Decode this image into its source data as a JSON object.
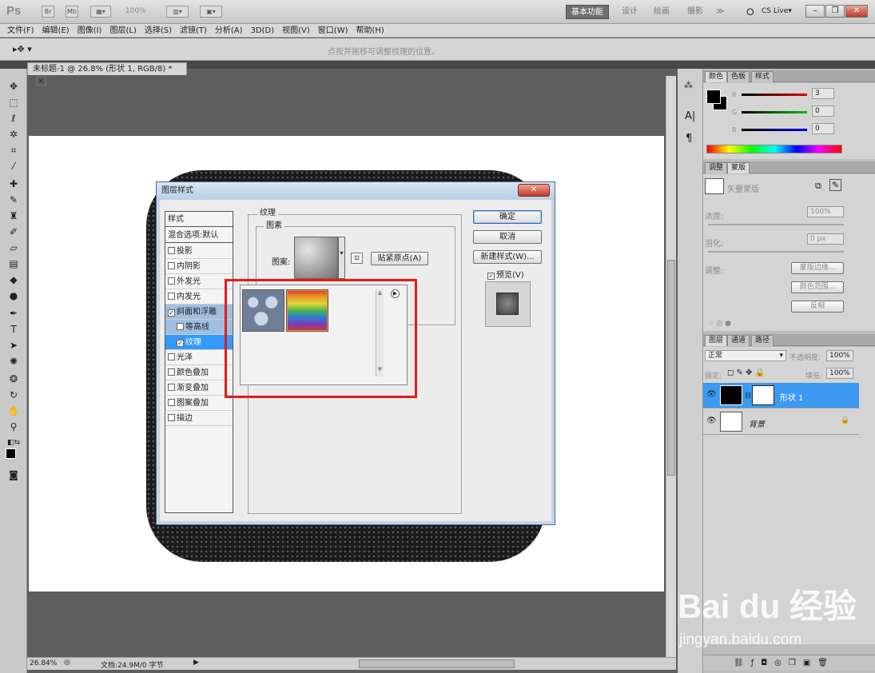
{
  "app": {
    "logo": "Ps",
    "zoom": "100%",
    "workspaces": [
      "基本功能",
      "设计",
      "绘画",
      "摄影",
      "≫"
    ],
    "cs_live": "CS Live▾"
  },
  "menu": [
    "文件(F)",
    "编辑(E)",
    "图像(I)",
    "图层(L)",
    "选择(S)",
    "滤镜(T)",
    "分析(A)",
    "3D(D)",
    "视图(V)",
    "窗口(W)",
    "帮助(H)"
  ],
  "options_bar": {
    "hint": "点按并拖移可调整纹理的位置。"
  },
  "document": {
    "tab": "未标题-1 @ 26.8% (形状 1, RGB/8) *",
    "status_zoom": "26.84%",
    "status_doc": "文档:24.9M/0 字节"
  },
  "dialog": {
    "title": "图层样式",
    "styles_header": "样式",
    "blend_options": "混合选项:默认",
    "items": [
      {
        "label": "投影",
        "checked": false
      },
      {
        "label": "内阴影",
        "checked": false
      },
      {
        "label": "外发光",
        "checked": false
      },
      {
        "label": "内发光",
        "checked": false
      },
      {
        "label": "斜面和浮雕",
        "checked": true
      },
      {
        "label": "等高线",
        "checked": false
      },
      {
        "label": "纹理",
        "checked": true
      },
      {
        "label": "光泽",
        "checked": false
      },
      {
        "label": "颜色叠加",
        "checked": false
      },
      {
        "label": "渐变叠加",
        "checked": false
      },
      {
        "label": "图案叠加",
        "checked": false
      },
      {
        "label": "描边",
        "checked": false
      }
    ],
    "section_title": "纹理",
    "subsection_title": "图素",
    "pattern_label": "图案:",
    "snap_button": "贴紧原点(A)",
    "ok": "确定",
    "cancel": "取消",
    "new_style": "新建样式(W)...",
    "preview": "预览(V)",
    "preview_checked": true
  },
  "color_panel": {
    "tabs": [
      "颜色",
      "色板",
      "样式"
    ],
    "channels": [
      {
        "label": "R",
        "value": "3",
        "color": "#d00000"
      },
      {
        "label": "G",
        "value": "0",
        "color": "#00a000"
      },
      {
        "label": "B",
        "value": "0",
        "color": "#0000d0"
      }
    ]
  },
  "masks_panel": {
    "tabs": [
      "调整",
      "蒙版"
    ],
    "title": "矢量蒙版",
    "density_label": "浓度:",
    "density_value": "100%",
    "feather_label": "羽化:",
    "feather_value": "0 px",
    "refine_label": "调整:",
    "buttons": [
      "蒙版边缘...",
      "颜色范围...",
      "反相"
    ]
  },
  "layers_panel": {
    "tabs": [
      "图层",
      "通道",
      "路径"
    ],
    "blend_mode": "正常",
    "opacity_label": "不透明度:",
    "opacity_value": "100%",
    "lock_label": "锁定:",
    "fill_label": "填充:",
    "fill_value": "100%",
    "layers": [
      {
        "name": "形状 1",
        "selected": true
      },
      {
        "name": "背景",
        "selected": false
      }
    ]
  },
  "watermark": {
    "brand": "Bai du 经验",
    "url": "jingyan.baidu.com"
  }
}
